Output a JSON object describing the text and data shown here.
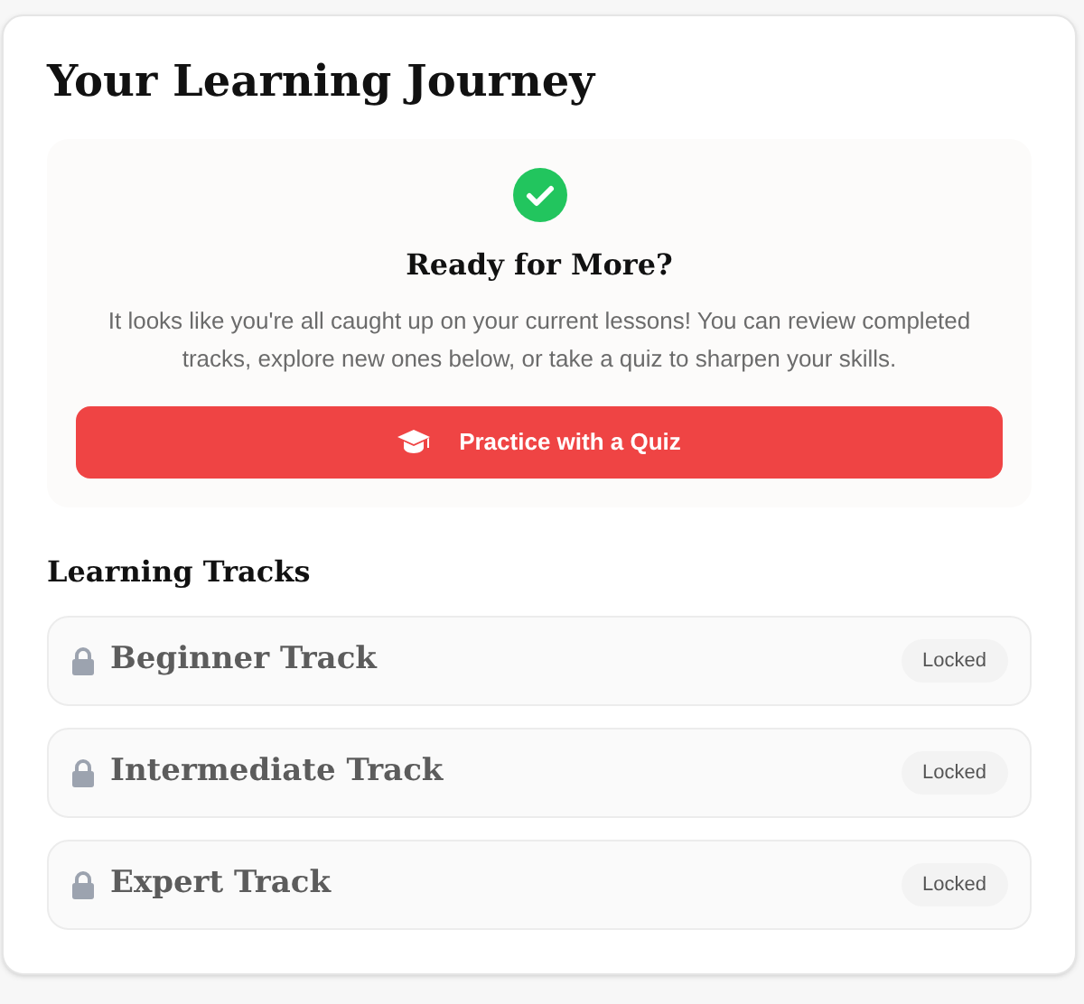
{
  "title": "Your Learning Journey",
  "summary": {
    "heading": "Ready for More?",
    "message": "It looks like you're all caught up on your current lessons! You can review completed tracks, explore new ones below, or take a quiz to sharpen your skills.",
    "button": "Practice with a Quiz"
  },
  "tracks_heading": "Learning Tracks",
  "tracks": [
    {
      "name": "Beginner Track",
      "locked": true,
      "status": "Locked"
    },
    {
      "name": "Intermediate Track",
      "locked": true,
      "status": "Locked"
    },
    {
      "name": "Expert Track",
      "locked": true,
      "status": "Locked"
    }
  ]
}
